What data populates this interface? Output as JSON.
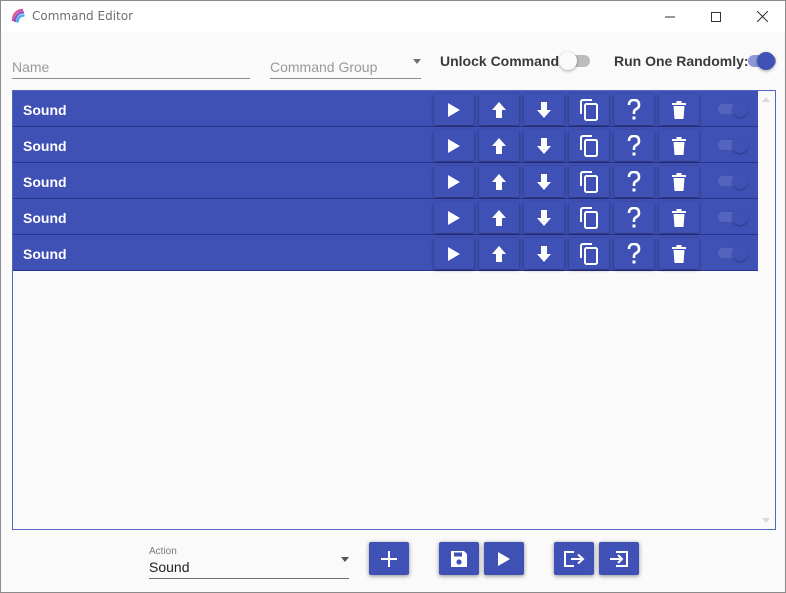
{
  "window": {
    "title": "Command Editor",
    "app_icon": "app-logo-icon",
    "controls": {
      "minimize": "minimize-icon",
      "maximize": "maximize-icon",
      "close": "close-icon"
    }
  },
  "form": {
    "name_placeholder": "Name",
    "group_placeholder": "Command Group",
    "unlock_label": "Unlock Command:",
    "unlock_on": false,
    "random_label": "Run One Randomly:",
    "random_on": true
  },
  "actions": [
    {
      "label": "Sound",
      "enabled": true
    },
    {
      "label": "Sound",
      "enabled": true
    },
    {
      "label": "Sound",
      "enabled": true
    },
    {
      "label": "Sound",
      "enabled": true
    },
    {
      "label": "Sound",
      "enabled": true
    }
  ],
  "row_buttons": [
    "play-icon",
    "move-up-icon",
    "move-down-icon",
    "duplicate-icon",
    "help-icon",
    "delete-icon"
  ],
  "footer": {
    "action_caption": "Action",
    "action_value": "Sound",
    "buttons": [
      "add-icon",
      "save-icon",
      "play-icon",
      "export-icon",
      "import-icon"
    ]
  },
  "colors": {
    "accent": "#3f51b5",
    "accent_dark": "#27348a",
    "text_muted": "#9a9a9a"
  }
}
